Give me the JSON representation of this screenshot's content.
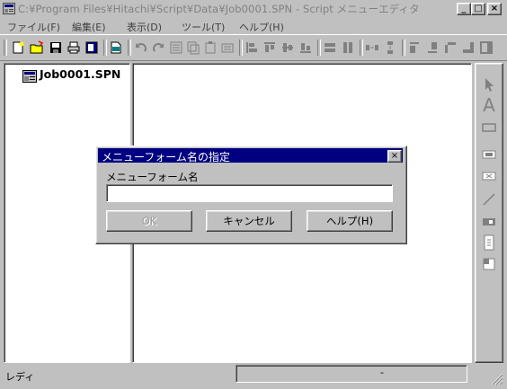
{
  "window": {
    "title": "C:¥Program Files¥Hitachi¥Script¥Data¥Job0001.SPN - Script メニューエディタ",
    "minimize": "_",
    "maximize": "□",
    "close": "×"
  },
  "menu": [
    {
      "label": "ファイル(F)"
    },
    {
      "label": "編集(E)"
    },
    {
      "label": "表示(D)"
    },
    {
      "label": "ツール(T)"
    },
    {
      "label": "ヘルプ(H)"
    }
  ],
  "tree": {
    "item": "Job0001.SPN"
  },
  "dialog": {
    "title": "メニューフォーム名の指定",
    "close": "×",
    "field_label": "メニューフォーム名",
    "field_value": "",
    "buttons": {
      "ok": "OK",
      "cancel": "キャンセル",
      "help": "ヘルプ(H)"
    }
  },
  "status": {
    "text": "レディ",
    "panel": "-"
  },
  "palette": {
    "text_tool": "A"
  }
}
